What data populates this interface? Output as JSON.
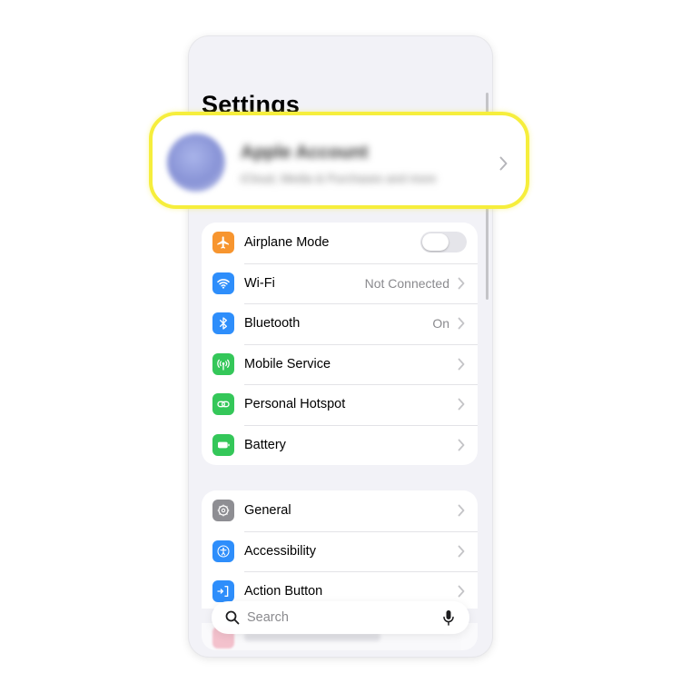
{
  "page": {
    "title": "Settings"
  },
  "profile": {
    "name": "Apple Account",
    "subtitle": "iCloud, Media & Purchases and more"
  },
  "connectivity": [
    {
      "label": "Airplane Mode",
      "value": "",
      "icon": "airplane-icon",
      "color": "#F7952F",
      "toggle": true,
      "toggle_on": false
    },
    {
      "label": "Wi-Fi",
      "value": "Not Connected",
      "icon": "wifi-icon",
      "color": "#2E8EFB"
    },
    {
      "label": "Bluetooth",
      "value": "On",
      "icon": "bluetooth-icon",
      "color": "#2E8EFB"
    },
    {
      "label": "Mobile Service",
      "value": "",
      "icon": "antenna-icon",
      "color": "#34C759"
    },
    {
      "label": "Personal Hotspot",
      "value": "",
      "icon": "link-icon",
      "color": "#34C759"
    },
    {
      "label": "Battery",
      "value": "",
      "icon": "battery-icon",
      "color": "#34C759"
    }
  ],
  "system": [
    {
      "label": "General",
      "value": "",
      "icon": "gear-icon",
      "color": "#8E8E93"
    },
    {
      "label": "Accessibility",
      "value": "",
      "icon": "accessibility-icon",
      "color": "#2E8EFB"
    },
    {
      "label": "Action Button",
      "value": "",
      "icon": "action-button-icon",
      "color": "#2E8EFB"
    }
  ],
  "search": {
    "placeholder": "Search"
  },
  "colors": {
    "highlight": "#F6EE3C",
    "background": "#F2F2F7"
  }
}
